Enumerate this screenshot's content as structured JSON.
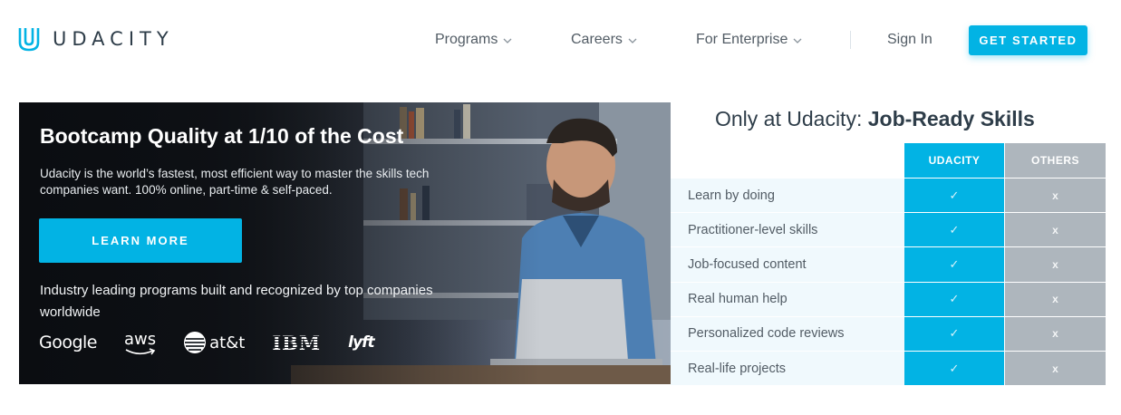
{
  "brand": {
    "name": "UDACITY",
    "accent": "#02b3e4"
  },
  "nav": {
    "items": [
      {
        "label": "Programs"
      },
      {
        "label": "Careers"
      },
      {
        "label": "For Enterprise"
      }
    ],
    "signin_label": "Sign In",
    "cta_label": "GET STARTED"
  },
  "hero": {
    "title": "Bootcamp Quality at 1/10 of the Cost",
    "subtitle": "Udacity is the world’s fastest, most efficient way to master the skills tech companies want. 100% online, part-time & self-paced.",
    "button_label": "LEARN MORE",
    "partners_text": "Industry leading programs built and recognized by top companies worldwide",
    "partners": [
      "Google",
      "aws",
      "at&t",
      "IBM",
      "lyft"
    ]
  },
  "comparison": {
    "heading_prefix": "Only at Udacity: ",
    "heading_bold": "Job-Ready Skills",
    "col_udacity": "UDACITY",
    "col_others": "OTHERS",
    "rows": [
      {
        "label": "Learn by doing",
        "udacity": "✓",
        "others": "x"
      },
      {
        "label": "Practitioner-level skills",
        "udacity": "✓",
        "others": "x"
      },
      {
        "label": "Job-focused content",
        "udacity": "✓",
        "others": "x"
      },
      {
        "label": "Real human help",
        "udacity": "✓",
        "others": "x"
      },
      {
        "label": "Personalized code reviews",
        "udacity": "✓",
        "others": "x"
      },
      {
        "label": "Real-life projects",
        "udacity": "✓",
        "others": "x"
      }
    ]
  }
}
